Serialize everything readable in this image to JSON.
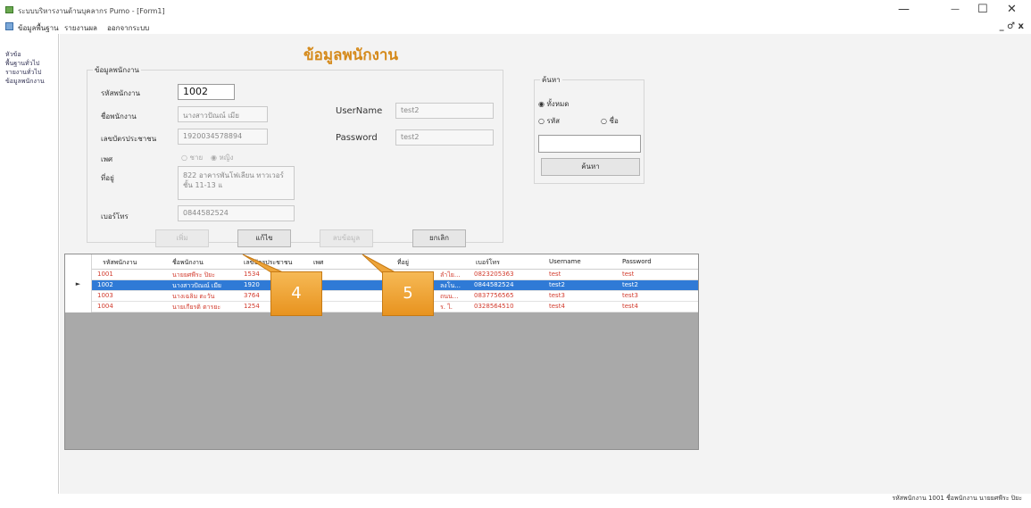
{
  "window": {
    "title": "ระบบบริหารงานด้านบุคลากร Pumo - [Form1]",
    "minimize": "—",
    "maximize": "☐",
    "close": "✕",
    "mdi_controls": "_ ♂ x"
  },
  "menu": [
    "ข้อมูลพื้นฐาน",
    "รายงานผล",
    "ออกจากระบบ"
  ],
  "sidebar": [
    "หัวข้อ",
    "พื้นฐานทั่วไป",
    "รายงานทั่วไป",
    "ข้อมูลพนักงาน"
  ],
  "form": {
    "title": "ข้อมูลพนักงาน",
    "employee_group": {
      "legend": "ข้อมูลพนักงาน",
      "fields": {
        "emp_id_label": "รหัสพนักงาน",
        "emp_id_value": "1002",
        "name_label": "ชื่อพนักงาน",
        "name_value": "นางสาวปัณณ์ เมีย",
        "citizen_label": "เลขบัตรประชาชน",
        "citizen_value": "1920034578894",
        "gender_label": "เพศ",
        "gender_male": "ชาย",
        "gender_female": "หญิง",
        "address_label": "ที่อยู่",
        "address_value": "822 อาคารพันโฟเลียน ทาวเวอร์ ชั้น 11-13 แ",
        "phone_label": "เบอร์โทร",
        "phone_value": "0844582524",
        "username_label": "UserName",
        "username_value": "test2",
        "password_label": "Password",
        "password_value": "test2"
      },
      "buttons": {
        "add": "เพิ่ม",
        "edit": "แก้ไข",
        "delete": "ลบข้อมูล",
        "cancel": "ยกเลิก"
      }
    },
    "search_group": {
      "legend": "ค้นหา",
      "option_all": "ทั้งหมด",
      "option_id": "รหัส",
      "option_name": "ชื่อ",
      "query": "",
      "button": "ค้นหา"
    }
  },
  "grid": {
    "columns": [
      "รหัสพนักงาน",
      "ชื่อพนักงาน",
      "เลขบัตรประชาชน",
      "เพศ",
      "ที่อยู่",
      "เบอร์โทร",
      "Username",
      "Password"
    ],
    "selected_marker": "►",
    "rows": [
      [
        "1001",
        "นายยศพีระ ปิยะ",
        "1534",
        "",
        "ลำไย...",
        "0823205363",
        "test",
        "test"
      ],
      [
        "1002",
        "นางสาวปัณณ์ เมีย",
        "1920",
        "",
        "ลงโน...",
        "0844582524",
        "test2",
        "test2"
      ],
      [
        "1003",
        "นางเฉลิม ตะวัน",
        "3764",
        "",
        "ถนน...",
        "0837756565",
        "test3",
        "test3"
      ],
      [
        "1004",
        "นายเกียรติ ตารยะ",
        "1254",
        "",
        "ร. ไ.",
        "0328564510",
        "test4",
        "test4"
      ]
    ]
  },
  "callouts": [
    "4",
    "5"
  ],
  "status": "รหัสพนักงาน 1001 ชื่อพนักงาน นายยศพีระ ปิยะ"
}
